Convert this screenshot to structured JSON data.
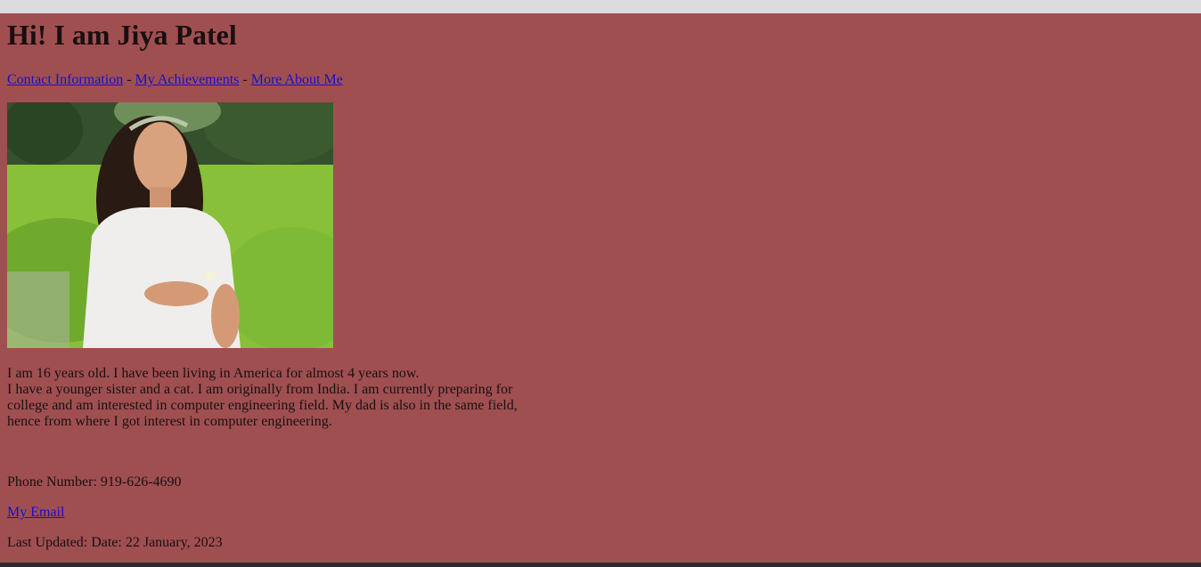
{
  "heading": "Hi! I am Jiya Patel",
  "nav": {
    "links": [
      "Contact Information",
      "My Achievements",
      "More About Me"
    ],
    "separator": " - "
  },
  "photo": {
    "icon": "portrait-photo"
  },
  "bio": {
    "line1": "I am 16 years old. I have been living in America for almost 4 years now.",
    "line2": "I have a younger sister and a cat. I am originally from India. I am currently preparing for college and am interested in computer engineering field. My dad is also in the same field, hence from where I got interest in computer engineering."
  },
  "contact": {
    "phone": "Phone Number: 919-626-4690",
    "email_link": "My Email",
    "last_updated": "Last Updated: Date: 22 January, 2023"
  },
  "colors": {
    "background": "#a04f51",
    "link": "#1a0dcc"
  }
}
